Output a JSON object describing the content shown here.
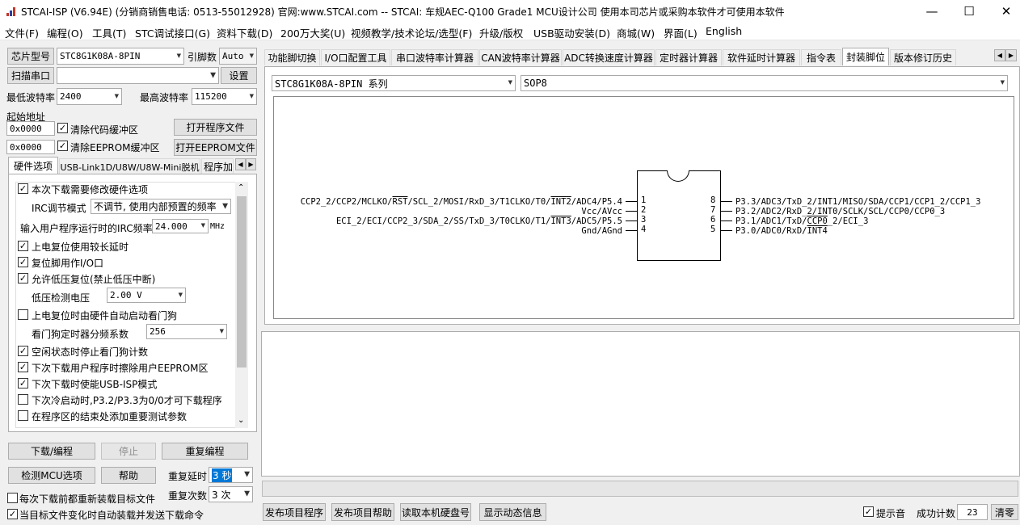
{
  "window": {
    "title": "STCAI-ISP (V6.94E) (分销商销售电话: 0513-55012928) 官网:www.STCAI.com  -- STCAI: 车规AEC-Q100 Grade1 MCU设计公司 使用本司芯片或采购本软件才可使用本软件",
    "minimize": "—",
    "maximize": "☐",
    "close": "✕"
  },
  "menu": [
    "文件(F)",
    "编程(O)",
    "工具(T)",
    "STC调试接口(G)",
    "资料下载(D)",
    "200万大奖(U)",
    "视频教学/技术论坛/选型(F)",
    "升级/版权",
    "USB驱动安装(D)",
    "商城(W)",
    "界面(L)",
    "English"
  ],
  "left": {
    "chip_label": "芯片型号",
    "chip_value": "STC8G1K08A-8PIN",
    "pin_label": "引脚数",
    "pin_value": "Auto",
    "scan_port": "扫描串口",
    "port_value": "",
    "settings": "设置",
    "min_baud_label": "最低波特率",
    "min_baud": "2400",
    "max_baud_label": "最高波特率",
    "max_baud": "115200",
    "start_addr_label": "起始地址",
    "addr1": "0x0000",
    "clear_code": "清除代码缓冲区",
    "open_prog": "打开程序文件",
    "addr2": "0x0000",
    "clear_eeprom": "清除EEPROM缓冲区",
    "open_eeprom": "打开EEPROM文件",
    "tabs": [
      "硬件选项",
      "USB-Link1D/U8W/U8W-Mini脱机",
      "程序加"
    ],
    "options": {
      "modify_hw": "本次下载需要修改硬件选项",
      "irc_label": "IRC调节模式",
      "irc_value": "不调节, 使用内部预置的频率",
      "freq_label": "输入用户程序运行时的IRC频率",
      "freq_value": "24.000",
      "freq_unit": "MHz",
      "por_delay": "上电复位使用较长延时",
      "reset_io": "复位脚用作I/O口",
      "lvr": "允许低压复位(禁止低压中断)",
      "lv_label": "低压检测电压",
      "lv_value": "2.00 V",
      "wdt_auto": "上电复位时由硬件自动启动看门狗",
      "wdt_div_label": "看门狗定时器分频系数",
      "wdt_div": "256",
      "wdt_idle": "空闲状态时停止看门狗计数",
      "erase_eeprom": "下次下载用户程序时擦除用户EEPROM区",
      "usb_isp": "下次下载时使能USB-ISP模式",
      "p32_p33": "下次冷启动时,P3.2/P3.3为0/0才可下载程序",
      "add_params": "在程序区的结束处添加重要测试参数"
    },
    "download": "下载/编程",
    "stop": "停止",
    "reprogram": "重复编程",
    "detect": "检测MCU选项",
    "help": "帮助",
    "repeat_delay_label": "重复延时",
    "repeat_delay": "3 秒",
    "repeat_count_label": "重复次数",
    "repeat_count": "3 次",
    "reload_each": "每次下载前都重新装载目标文件",
    "auto_reload": "当目标文件变化时自动装载并发送下载命令"
  },
  "right_tabs": [
    "功能脚切换",
    "I/O口配置工具",
    "串口波特率计算器",
    "CAN波特率计算器",
    "ADC转换速度计算器",
    "定时器计算器",
    "软件延时计算器",
    "指令表",
    "封装脚位",
    "版本修订历史"
  ],
  "package": {
    "series": "STC8G1K08A-8PIN 系列",
    "type": "SOP8",
    "left_pins": [
      {
        "num": "1",
        "pre": "CCP2_2/CCP2/MCLKO/",
        "ovl": "RST",
        "mid": "/SCL_2/MOSI/RxD_3/T1CLKO/T0/",
        "ovl2": "INT2",
        "post": "/ADC4/P5.4"
      },
      {
        "num": "2",
        "pre": "Vcc/AVcc",
        "ovl": "",
        "mid": "",
        "ovl2": "",
        "post": ""
      },
      {
        "num": "3",
        "pre": "ECI_2/ECI/CCP2_3/SDA_2/SS/TxD_3/T0CLKO/T1/",
        "ovl": "INT3",
        "mid": "/ADC5/P5.5",
        "ovl2": "",
        "post": ""
      },
      {
        "num": "4",
        "pre": "Gnd/AGnd",
        "ovl": "",
        "mid": "",
        "ovl2": "",
        "post": ""
      }
    ],
    "right_pins": [
      {
        "num": "8",
        "pre": "P3.3/ADC3/TxD_2/INT1/MISO/SDA/CCP1/CCP1_2/CCP1_3",
        "ovl": "",
        "post": ""
      },
      {
        "num": "7",
        "pre": "P3.2/ADC2/RxD_2/INT0/SCLK/SCL/CCP0/CCP0_3",
        "ovl": "",
        "post": ""
      },
      {
        "num": "6",
        "pre": "P3.1/ADC1/TxD/",
        "ovl": "CCP0",
        "post": "_2/ECI_3"
      },
      {
        "num": "5",
        "pre": "P3.0/ADC0/RxD/",
        "ovl": "INT4",
        "post": ""
      }
    ]
  },
  "bottom": {
    "publish_prog": "发布项目程序",
    "publish_help": "发布项目帮助",
    "read_disk": "读取本机硬盘号",
    "show_dynamic": "显示动态信息",
    "beep": "提示音",
    "success_label": "成功计数",
    "success_count": "23",
    "clear": "清零"
  }
}
